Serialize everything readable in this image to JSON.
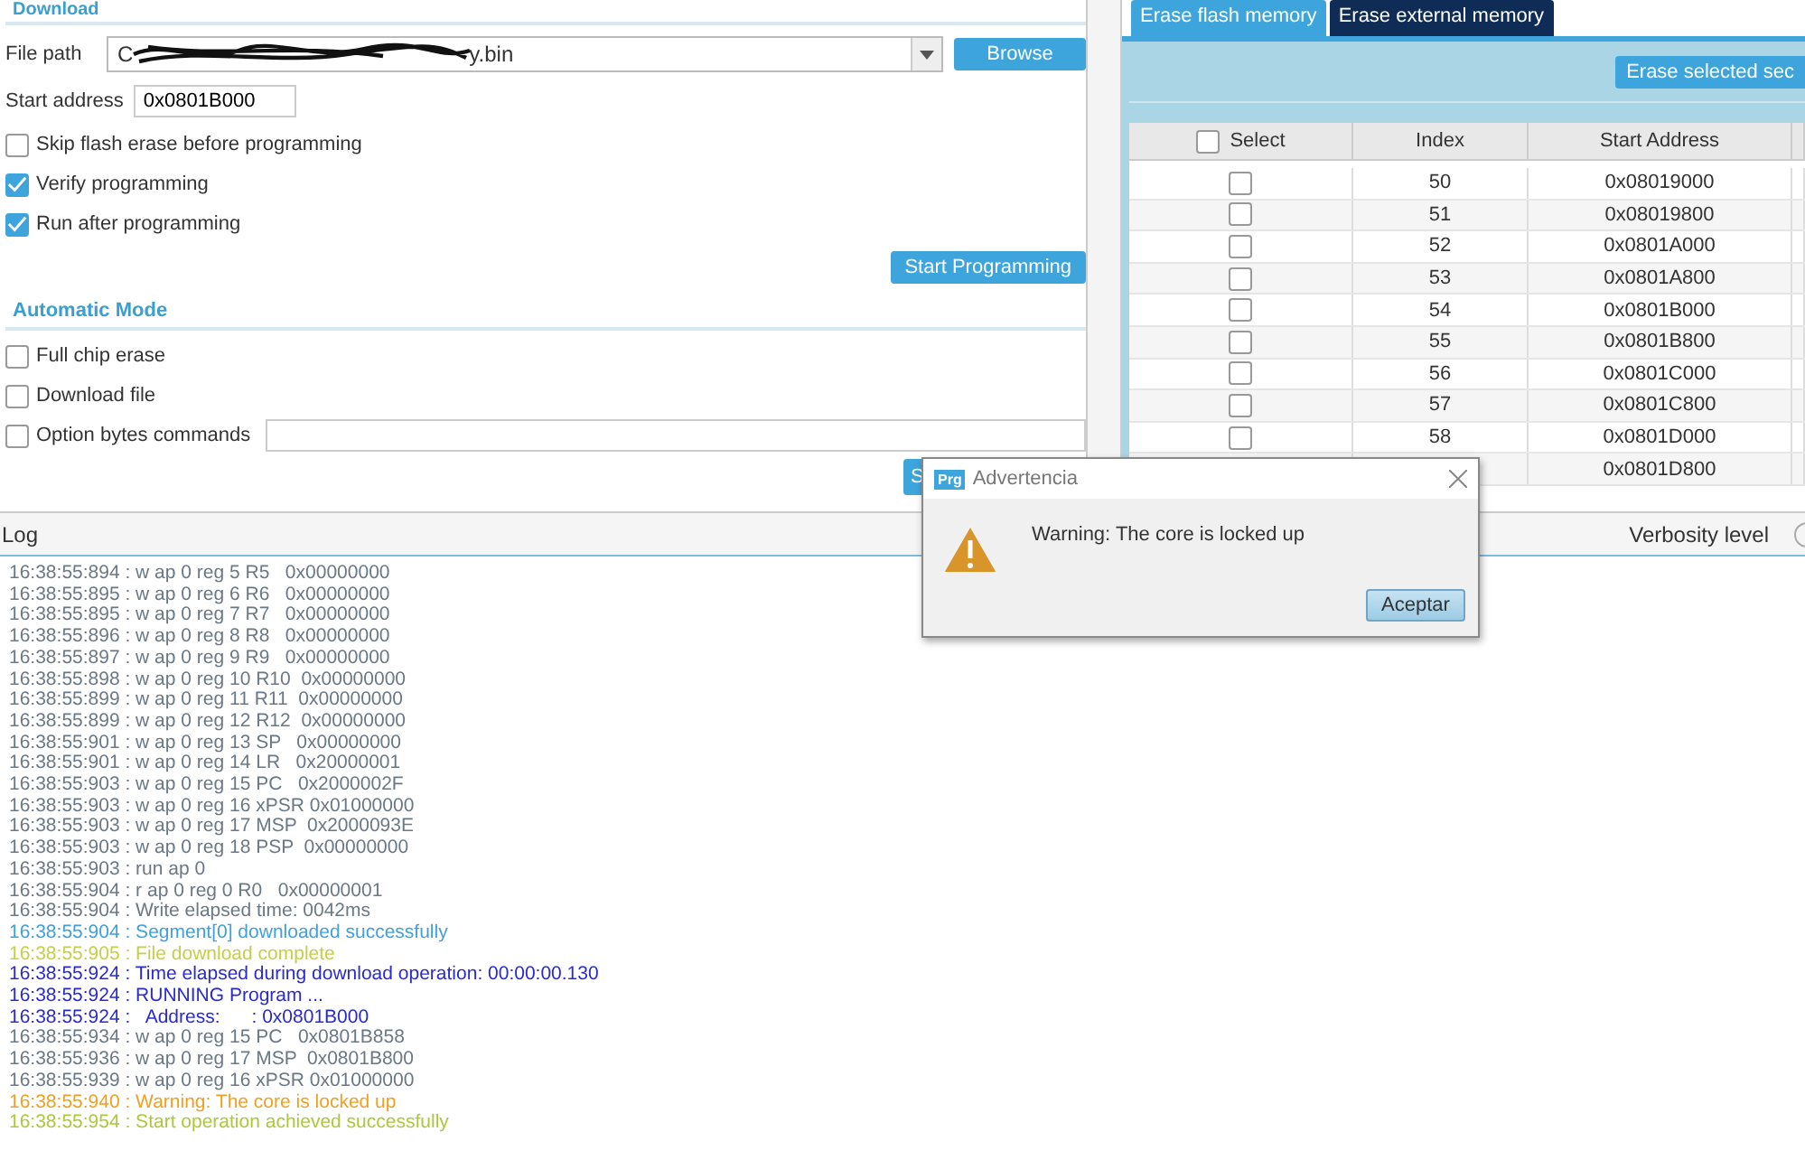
{
  "download": {
    "title": "Download",
    "file_path": {
      "label": "File path",
      "value_start": "C",
      "value_end": "y.bin",
      "redacted": true
    },
    "browse_button": "Browse",
    "start_address": {
      "label": "Start address",
      "value": "0x0801B000"
    },
    "options": [
      {
        "label": "Skip flash erase before programming",
        "checked": false
      },
      {
        "label": "Verify programming",
        "checked": true
      },
      {
        "label": "Run after programming",
        "checked": true
      }
    ],
    "start_button": "Start Programming"
  },
  "automatic_mode": {
    "title": "Automatic Mode",
    "options": [
      {
        "label": "Full chip erase",
        "checked": false,
        "kind": "plain"
      },
      {
        "label": "Download file",
        "checked": false,
        "kind": "plain"
      },
      {
        "label": "Option bytes commands",
        "checked": false,
        "kind": "field"
      }
    ],
    "start_button": "S"
  },
  "erase": {
    "tabs": [
      {
        "label": "Erase flash memory",
        "selected": true
      },
      {
        "label": "Erase external memory",
        "selected": false
      }
    ],
    "erase_button": "Erase selected sec",
    "columns": [
      "Select",
      "Index",
      "Start Address"
    ],
    "header_checked": false,
    "rows": [
      {
        "index": "50",
        "address": "0x08019000",
        "checked": false
      },
      {
        "index": "51",
        "address": "0x08019800",
        "checked": false
      },
      {
        "index": "52",
        "address": "0x0801A000",
        "checked": false
      },
      {
        "index": "53",
        "address": "0x0801A800",
        "checked": false
      },
      {
        "index": "54",
        "address": "0x0801B000",
        "checked": false
      },
      {
        "index": "55",
        "address": "0x0801B800",
        "checked": false
      },
      {
        "index": "56",
        "address": "0x0801C000",
        "checked": false
      },
      {
        "index": "57",
        "address": "0x0801C800",
        "checked": false
      },
      {
        "index": "58",
        "address": "0x0801D000",
        "checked": false
      },
      {
        "address": "0x0801D800"
      }
    ]
  },
  "log": {
    "title": "Log",
    "verbosity_label": "Verbosity level",
    "verbosity_radio_selected": false,
    "lines": [
      {
        "text": "16:38:55:894 : w ap 0 reg 5 R5   0x00000000",
        "kind": "normal"
      },
      {
        "text": "16:38:55:895 : w ap 0 reg 6 R6   0x00000000",
        "kind": "normal"
      },
      {
        "text": "16:38:55:895 : w ap 0 reg 7 R7   0x00000000",
        "kind": "normal"
      },
      {
        "text": "16:38:55:896 : w ap 0 reg 8 R8   0x00000000",
        "kind": "normal"
      },
      {
        "text": "16:38:55:897 : w ap 0 reg 9 R9   0x00000000",
        "kind": "normal"
      },
      {
        "text": "16:38:55:898 : w ap 0 reg 10 R10  0x00000000",
        "kind": "normal"
      },
      {
        "text": "16:38:55:899 : w ap 0 reg 11 R11  0x00000000",
        "kind": "normal"
      },
      {
        "text": "16:38:55:899 : w ap 0 reg 12 R12  0x00000000",
        "kind": "normal"
      },
      {
        "text": "16:38:55:901 : w ap 0 reg 13 SP   0x00000000",
        "kind": "normal"
      },
      {
        "text": "16:38:55:901 : w ap 0 reg 14 LR   0x20000001",
        "kind": "normal"
      },
      {
        "text": "16:38:55:903 : w ap 0 reg 15 PC   0x2000002F",
        "kind": "normal"
      },
      {
        "text": "16:38:55:903 : w ap 0 reg 16 xPSR 0x01000000",
        "kind": "normal"
      },
      {
        "text": "16:38:55:903 : w ap 0 reg 17 MSP  0x2000093E",
        "kind": "normal"
      },
      {
        "text": "16:38:55:903 : w ap 0 reg 18 PSP  0x00000000",
        "kind": "normal"
      },
      {
        "text": "16:38:55:903 : run ap 0",
        "kind": "normal"
      },
      {
        "text": "16:38:55:904 : r ap 0 reg 0 R0   0x00000001",
        "kind": "normal"
      },
      {
        "text": "16:38:55:904 : Write elapsed time: 0042ms",
        "kind": "normal"
      },
      {
        "text": "16:38:55:904 : Segment[0] downloaded successfully",
        "kind": "info"
      },
      {
        "text": "16:38:55:905 : File download complete",
        "kind": "complete"
      },
      {
        "text": "16:38:55:924 : Time elapsed during download operation: 00:00:00.130",
        "kind": "highlight"
      },
      {
        "text": "16:38:55:924 : RUNNING Program ...",
        "kind": "highlight"
      },
      {
        "text": "16:38:55:924 :   Address:      : 0x0801B000",
        "kind": "highlight"
      },
      {
        "text": "16:38:55:934 : w ap 0 reg 15 PC   0x0801B858",
        "kind": "normal"
      },
      {
        "text": "16:38:55:936 : w ap 0 reg 17 MSP  0x0801B800",
        "kind": "normal"
      },
      {
        "text": "16:38:55:939 : w ap 0 reg 16 xPSR 0x01000000",
        "kind": "normal"
      },
      {
        "text": "16:38:55:940 : Warning: The core is locked up",
        "kind": "warning"
      },
      {
        "text": "16:38:55:954 : Start operation achieved successfully",
        "kind": "success"
      }
    ]
  },
  "dialog": {
    "title": "Advertencia",
    "app_badge": "Prg",
    "message": "Warning: The core is locked up",
    "button": "Aceptar"
  }
}
